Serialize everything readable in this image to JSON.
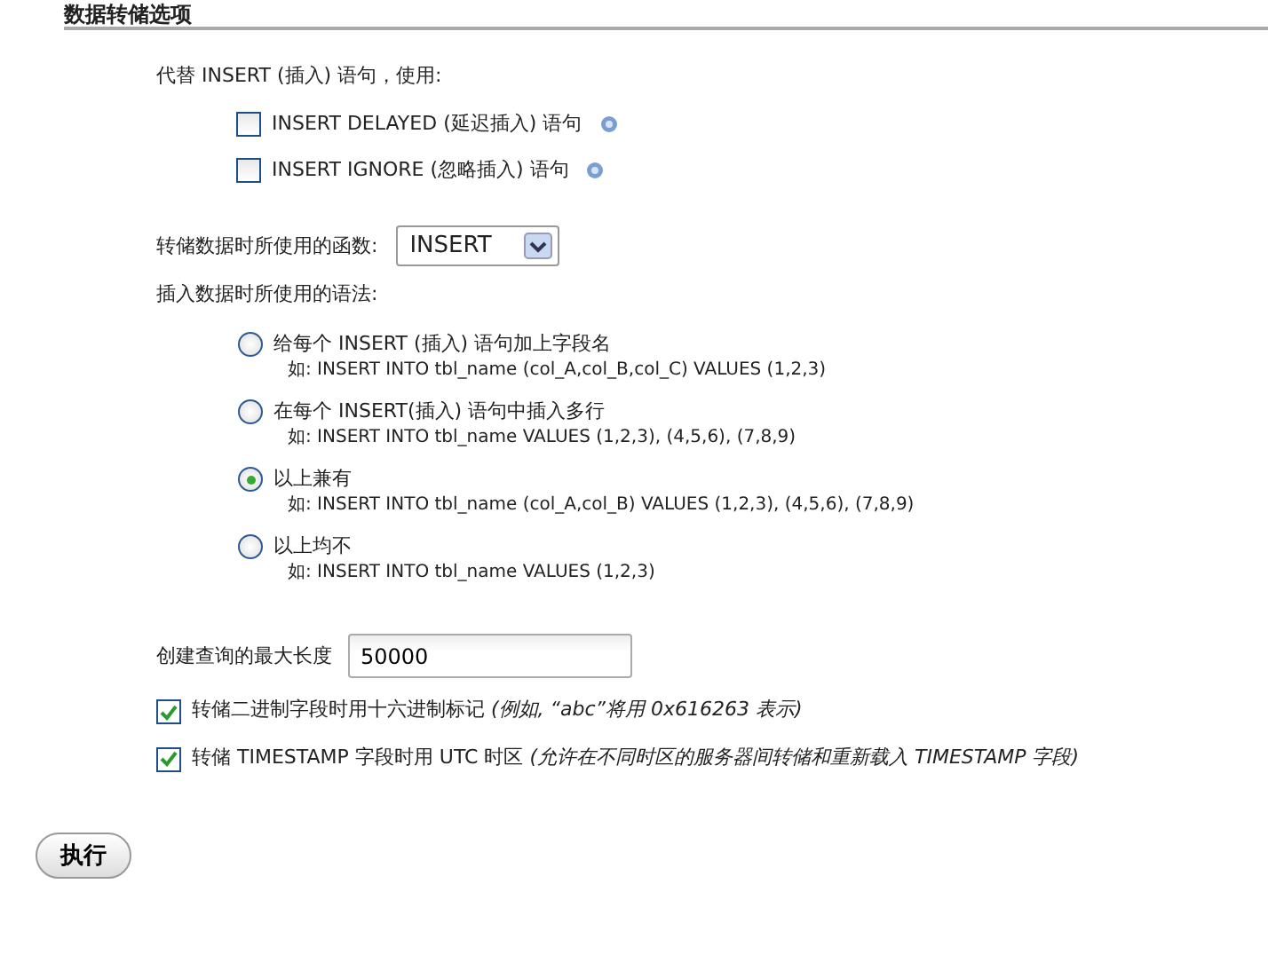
{
  "section_title": "数据转储选项",
  "insert_replacement": {
    "label": "代替 INSERT (插入) 语句，使用:",
    "options": [
      {
        "label": "INSERT DELAYED (延迟插入) 语句",
        "checked": false
      },
      {
        "label": "INSERT IGNORE (忽略插入) 语句",
        "checked": false
      }
    ]
  },
  "dump_function": {
    "label": "转储数据时所使用的函数:",
    "value": "INSERT"
  },
  "syntax": {
    "label": "插入数据时所使用的语法:",
    "options": [
      {
        "label": "给每个 INSERT (插入) 语句加上字段名",
        "example": "如: INSERT INTO tbl_name (col_A,col_B,col_C) VALUES (1,2,3)",
        "selected": false
      },
      {
        "label": "在每个 INSERT(插入) 语句中插入多行",
        "example": "如: INSERT INTO tbl_name VALUES (1,2,3), (4,5,6), (7,8,9)",
        "selected": false
      },
      {
        "label": "以上兼有",
        "example": "如: INSERT INTO tbl_name (col_A,col_B) VALUES (1,2,3), (4,5,6), (7,8,9)",
        "selected": true
      },
      {
        "label": "以上均不",
        "example": "如: INSERT INTO tbl_name VALUES (1,2,3)",
        "selected": false
      }
    ]
  },
  "max_query_length": {
    "label": "创建查询的最大长度",
    "value": "50000"
  },
  "flags": [
    {
      "label": "转储二进制字段时用十六进制标记 *(例如, “abc”将用 0x616263 表示)*",
      "checked": true
    },
    {
      "label": "转储 TIMESTAMP 字段时用 UTC 时区 *(允许在不同时区的服务器间转储和重新载入 TIMESTAMP 字段)*",
      "checked": true
    }
  ],
  "submit_button": "执行"
}
